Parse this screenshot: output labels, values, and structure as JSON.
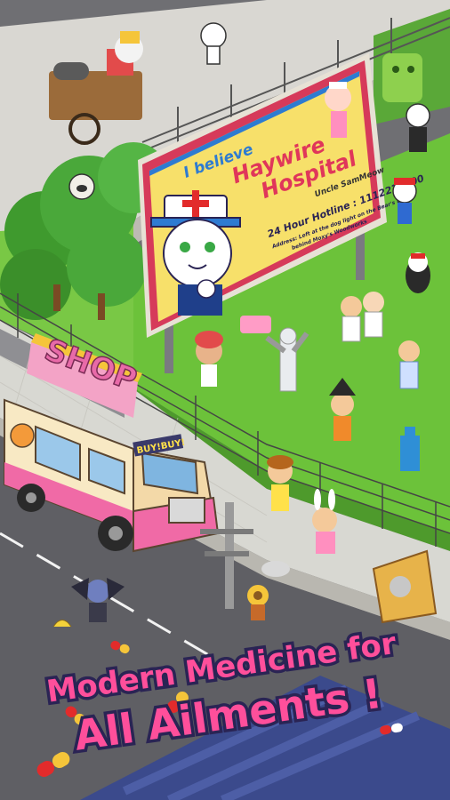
{
  "billboard": {
    "line1": "I believe",
    "line2": "Haywire",
    "line3": "Hospital",
    "signature": "Uncle SamMeow",
    "hotline": "24 Hour Hotline : 1112222000",
    "address_1": "Address: Left at the dog light on the Bear's Lane",
    "address_2": "behind Moxy's Woodworks"
  },
  "shop": {
    "sign": "SHOP",
    "truck_window": "BUY!BUY!"
  },
  "tagline": {
    "line1": "Modern Medicine for",
    "line2": "All Ailments !"
  },
  "colors": {
    "tagline_fill": "#ff4f9b",
    "tagline_outline": "#2a2454",
    "grass": "#6cc23a",
    "billboard_border": "#d63a5a",
    "billboard_inner": "#f7e06a",
    "truck_body": "#f8e9c4",
    "truck_lower": "#f06aa6"
  }
}
